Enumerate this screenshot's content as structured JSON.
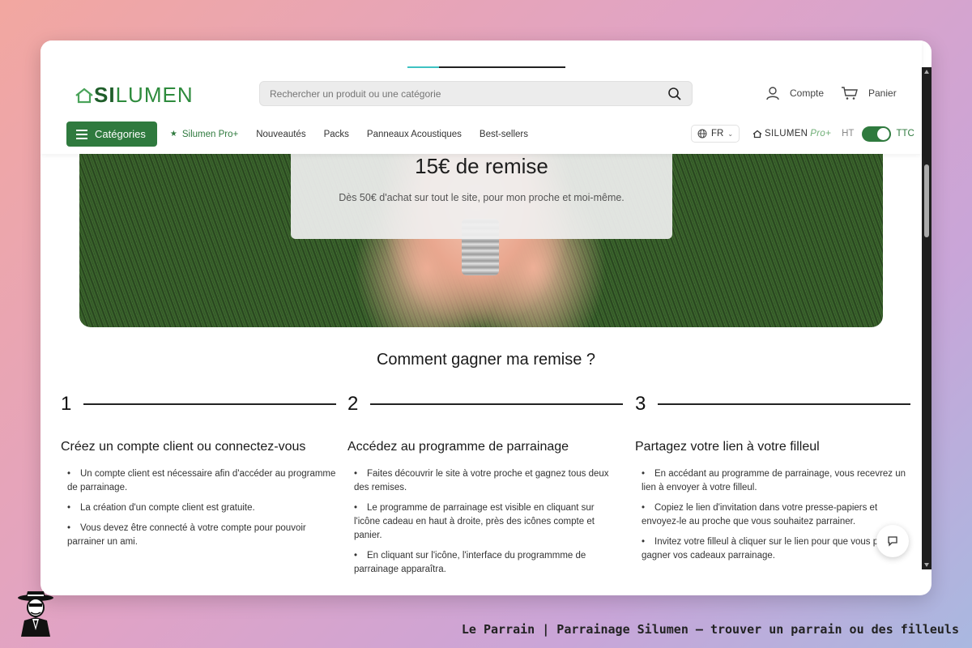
{
  "header": {
    "logo_text": "SILUMEN",
    "search_placeholder": "Rechercher un produit ou une catégorie",
    "account_label": "Compte",
    "cart_label": "Panier",
    "loading_progress": 0.2
  },
  "nav": {
    "categories_label": "Catégories",
    "items": [
      "Silumen Pro+",
      "Nouveautés",
      "Packs",
      "Panneaux Acoustiques",
      "Best-sellers"
    ],
    "language": "FR",
    "brand_pro_name": "SILUMEN",
    "brand_pro_suffix": "Pro+",
    "price_mode_left": "HT",
    "price_mode_right": "TTC",
    "ttc_enabled": true
  },
  "hero": {
    "title": "15€ de remise",
    "subtitle": "Dès 50€ d'achat sur tout le site, pour mon proche et moi-même."
  },
  "how_to": {
    "title": "Comment gagner ma remise ?",
    "steps": [
      {
        "number": "1",
        "title": "Créez un compte client ou connectez-vous",
        "bullets": [
          "Un compte client est nécessaire afin d'accéder au programme de parrainage.",
          "La création d'un compte client est gratuite.",
          "Vous devez être connecté à votre compte pour pouvoir parrainer un ami."
        ]
      },
      {
        "number": "2",
        "title": "Accédez au programme de parrainage",
        "bullets": [
          "Faites découvrir le site à votre proche et gagnez tous deux des remises.",
          "Le programme de parrainage est visible en cliquant sur l'icône cadeau en haut à droite, près des icônes compte et panier.",
          "En cliquant sur l'icône, l'interface du programmme de parrainage apparaîtra."
        ]
      },
      {
        "number": "3",
        "title": "Partagez votre lien à votre filleul",
        "bullets": [
          "En accédant au programme de parrainage, vous recevrez un lien à envoyer à votre filleul.",
          "Copiez le lien d'invitation dans votre presse-papiers et envoyez-le au proche que vous souhaitez parrainer.",
          "Invitez votre filleul à cliquer sur le lien pour que vous puissez gagner vos cadeaux parrainage."
        ]
      }
    ]
  },
  "footer": {
    "caption": "Le Parrain | Parrainage Silumen — trouver un parrain ou des filleuls"
  },
  "colors": {
    "brand_green": "#2f7a3e",
    "accent_cyan": "#3ec2c2"
  }
}
